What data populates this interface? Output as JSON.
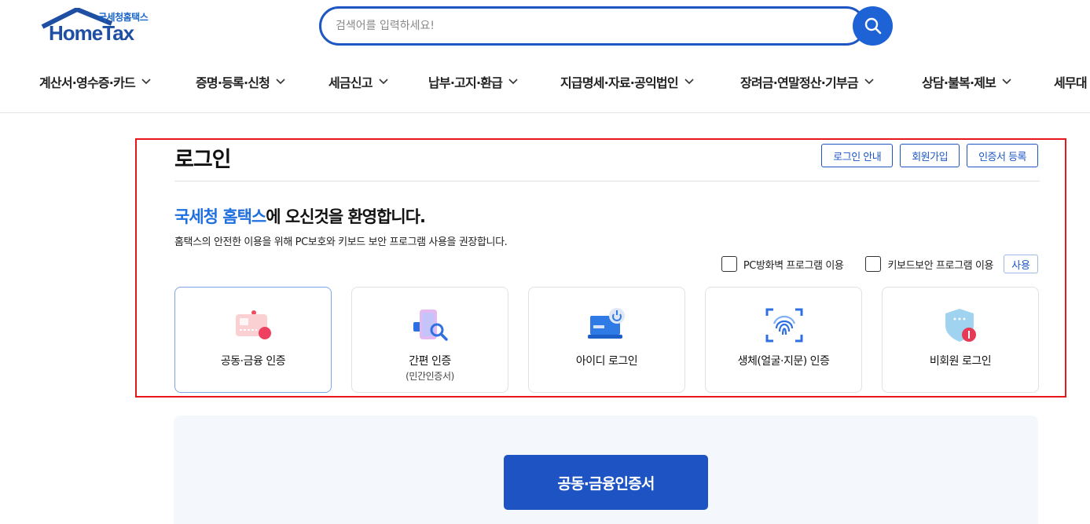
{
  "logo": {
    "sub": "국세청홈택스",
    "main": "HomeTax"
  },
  "search": {
    "placeholder": "검색어를 입력하세요!",
    "value": ""
  },
  "nav": [
    {
      "label": "계산서·영수증·카드"
    },
    {
      "label": "증명·등록·신청"
    },
    {
      "label": "세금신고"
    },
    {
      "label": "납부·고지·환급"
    },
    {
      "label": "지급명세·자료·공익법인"
    },
    {
      "label": "장려금·연말정산·기부금"
    },
    {
      "label": "상담·불복·제보"
    },
    {
      "label": "세무대"
    }
  ],
  "login": {
    "title": "로그인",
    "buttons": {
      "guide": "로그인 안내",
      "join": "회원가입",
      "cert_register": "인증서 등록"
    },
    "welcome_highlight": "국세청 홈택스",
    "welcome_rest": "에 오신것을 환영합니다.",
    "notice": "홈택스의 안전한 이용을 위해 PC보호와 키보드 보안 프로그램 사용을 권장합니다.",
    "options": {
      "firewall": "PC방화벽 프로그램 이용",
      "keyboard": "키보드보안 프로그램 이용",
      "use": "사용"
    },
    "methods": [
      {
        "label": "공동·금융 인증",
        "sub": "",
        "icon": "cert-card-icon",
        "active": true
      },
      {
        "label": "간편 인증",
        "sub": "(민간인증서)",
        "icon": "phone-search-icon",
        "active": false
      },
      {
        "label": "아이디 로그인",
        "sub": "",
        "icon": "laptop-power-icon",
        "active": false
      },
      {
        "label": "생체(얼굴·지문) 인증",
        "sub": "",
        "icon": "fingerprint-icon",
        "active": false
      },
      {
        "label": "비회원 로그인",
        "sub": "",
        "icon": "shield-icon",
        "active": false
      }
    ]
  },
  "cert_button": "공동·금융인증서",
  "colors": {
    "brand": "#1e56c4",
    "highlight": "#1f6fe0",
    "panel_border": "#e8161b"
  }
}
